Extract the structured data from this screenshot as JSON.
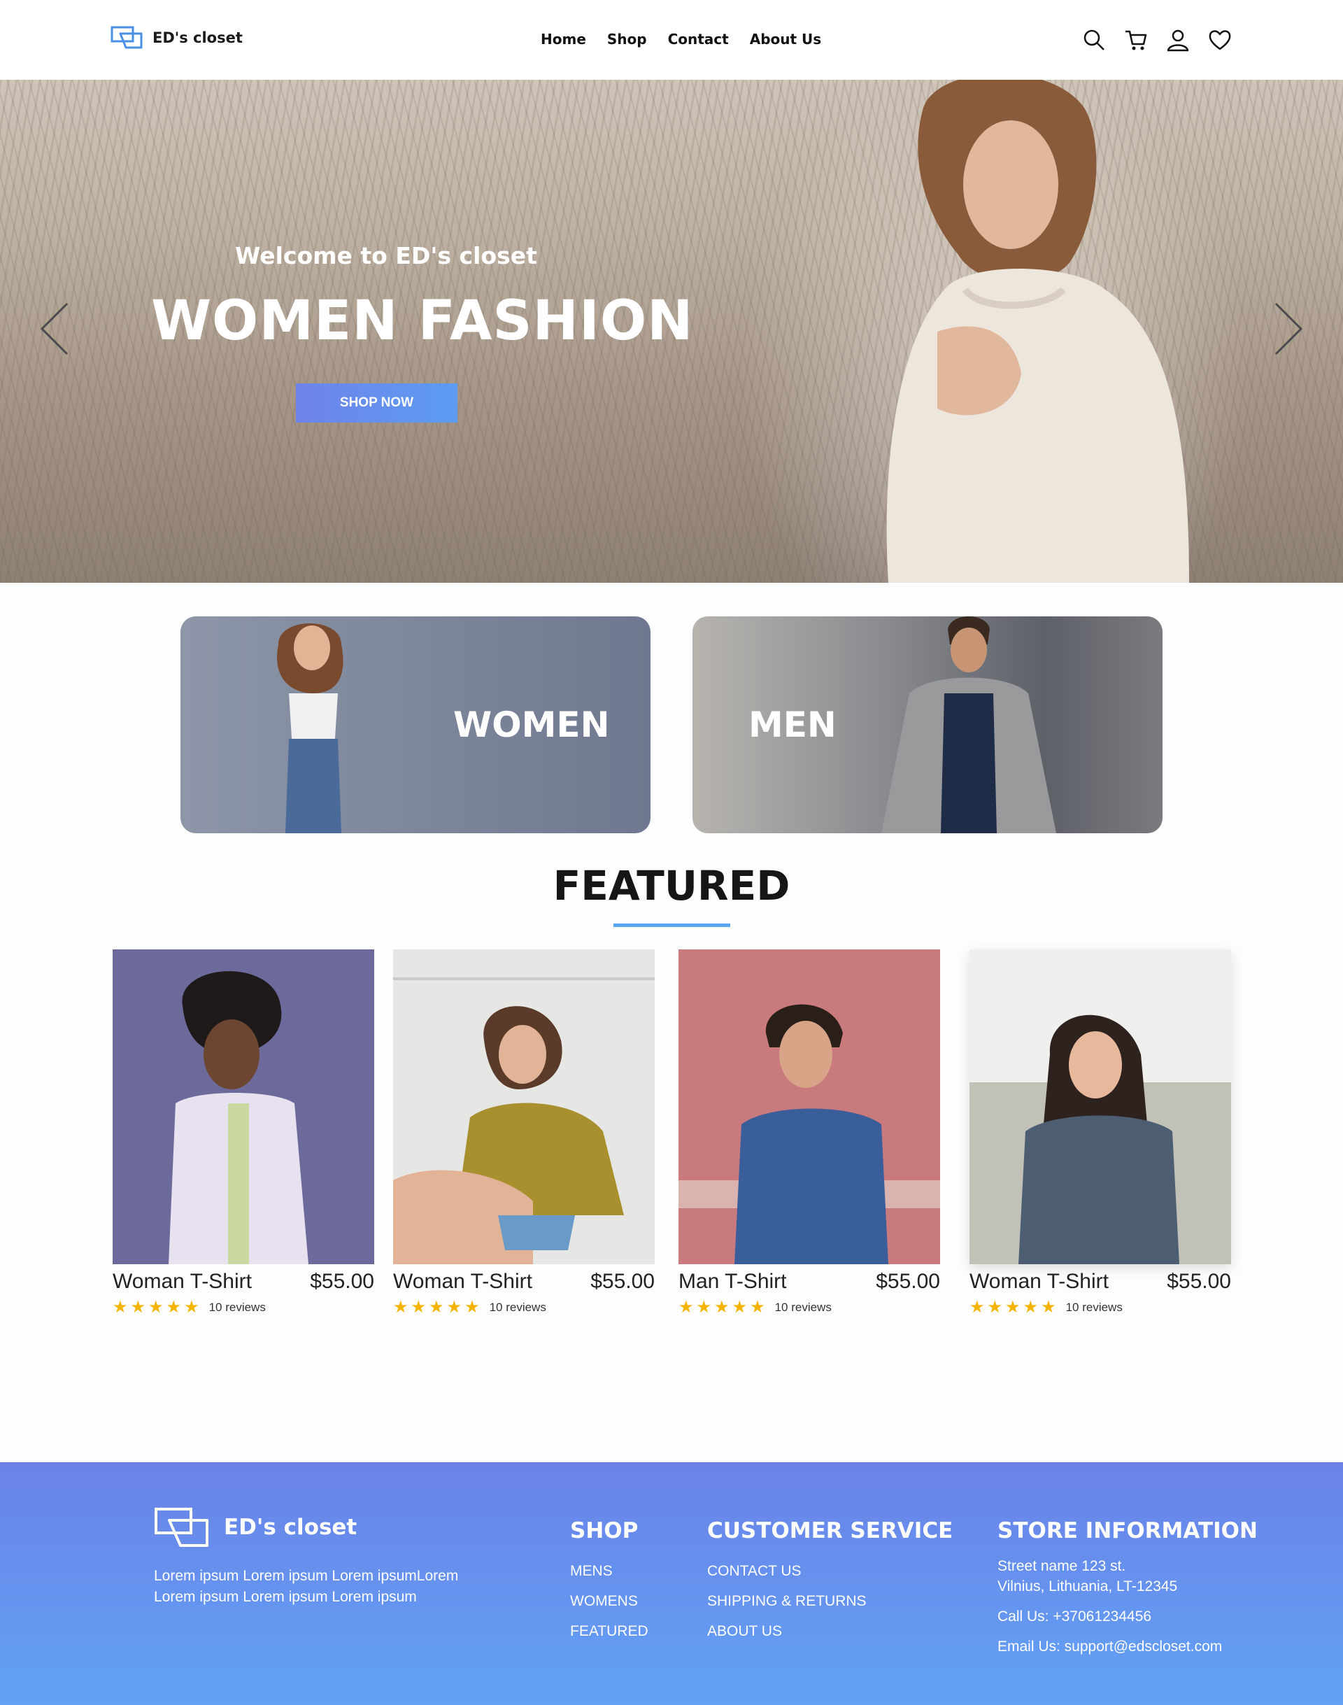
{
  "brand": {
    "name": "ED's closet",
    "accent": "#5b9cf2"
  },
  "nav": {
    "links": [
      "Home",
      "Shop",
      "Contact",
      "About Us"
    ],
    "icons": [
      "search-icon",
      "cart-icon",
      "user-icon",
      "heart-icon"
    ]
  },
  "hero": {
    "subtitle": "Welcome to ED's closet",
    "title": "WOMEN FASHION",
    "button": "SHOP NOW"
  },
  "categories": [
    "WOMEN",
    "MEN"
  ],
  "featured": {
    "title": "FEATURED",
    "products": [
      {
        "name": "Woman T-Shirt",
        "price": "$55.00",
        "rating": 5,
        "reviews": "10 reviews"
      },
      {
        "name": "Woman T-Shirt",
        "price": "$55.00",
        "rating": 5,
        "reviews": "10 reviews"
      },
      {
        "name": "Man T-Shirt",
        "price": "$55.00",
        "rating": 5,
        "reviews": "10 reviews"
      },
      {
        "name": "Woman T-Shirt",
        "price": "$55.00",
        "rating": 5,
        "reviews": "10 reviews"
      }
    ]
  },
  "footer": {
    "brand": "ED's closet",
    "description": "Lorem ipsum Lorem ipsum Lorem ipsumLorem Lorem ipsum Lorem ipsum Lorem ipsum",
    "shop": {
      "title": "SHOP",
      "links": [
        "MENS",
        "WOMENS",
        "FEATURED"
      ]
    },
    "service": {
      "title": "CUSTOMER SERVICE",
      "links": [
        "CONTACT US",
        "SHIPPING & RETURNS",
        "ABOUT US"
      ]
    },
    "store": {
      "title": "STORE INFORMATION",
      "address_line1": "Street name 123 st.",
      "address_line2": "Vilnius, Lithuania, LT-12345",
      "phone": "Call Us: +37061234456",
      "email": "Email Us: support@edscloset.com"
    }
  }
}
